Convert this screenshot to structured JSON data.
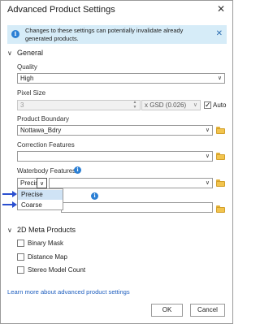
{
  "window": {
    "title": "Advanced Product Settings",
    "close_glyph": "✕"
  },
  "banner": {
    "message": "Changes to these settings can potentially invalidate already generated products.",
    "dismiss_glyph": "✕"
  },
  "general": {
    "header": "General",
    "quality": {
      "label": "Quality",
      "value": "High"
    },
    "pixel_size": {
      "label": "Pixel Size",
      "value": "3",
      "unit": "x GSD (0.026)",
      "auto_label": "Auto",
      "auto_checked": true
    },
    "product_boundary": {
      "label": "Product Boundary",
      "value": "Nottawa_Bdry"
    },
    "correction_features": {
      "label": "Correction Features",
      "value": ""
    },
    "waterbody_features": {
      "label": "Waterbody Features",
      "value": "Precise",
      "options": [
        "Precise",
        "Coarse"
      ],
      "highlighted": "Precise"
    }
  },
  "meta": {
    "header": "2D Meta Products",
    "items": [
      {
        "label": "Binary Mask",
        "checked": false
      },
      {
        "label": "Distance Map",
        "checked": false
      },
      {
        "label": "Stereo Model Count",
        "checked": false
      }
    ]
  },
  "footer": {
    "link": "Learn more about advanced product settings",
    "ok": "OK",
    "cancel": "Cancel"
  },
  "colors": {
    "accent": "#2b7fd4",
    "banner_bg": "#d6ecf8",
    "annotation_arrow": "#2a4fd0",
    "highlight": "#cfe3f5"
  }
}
